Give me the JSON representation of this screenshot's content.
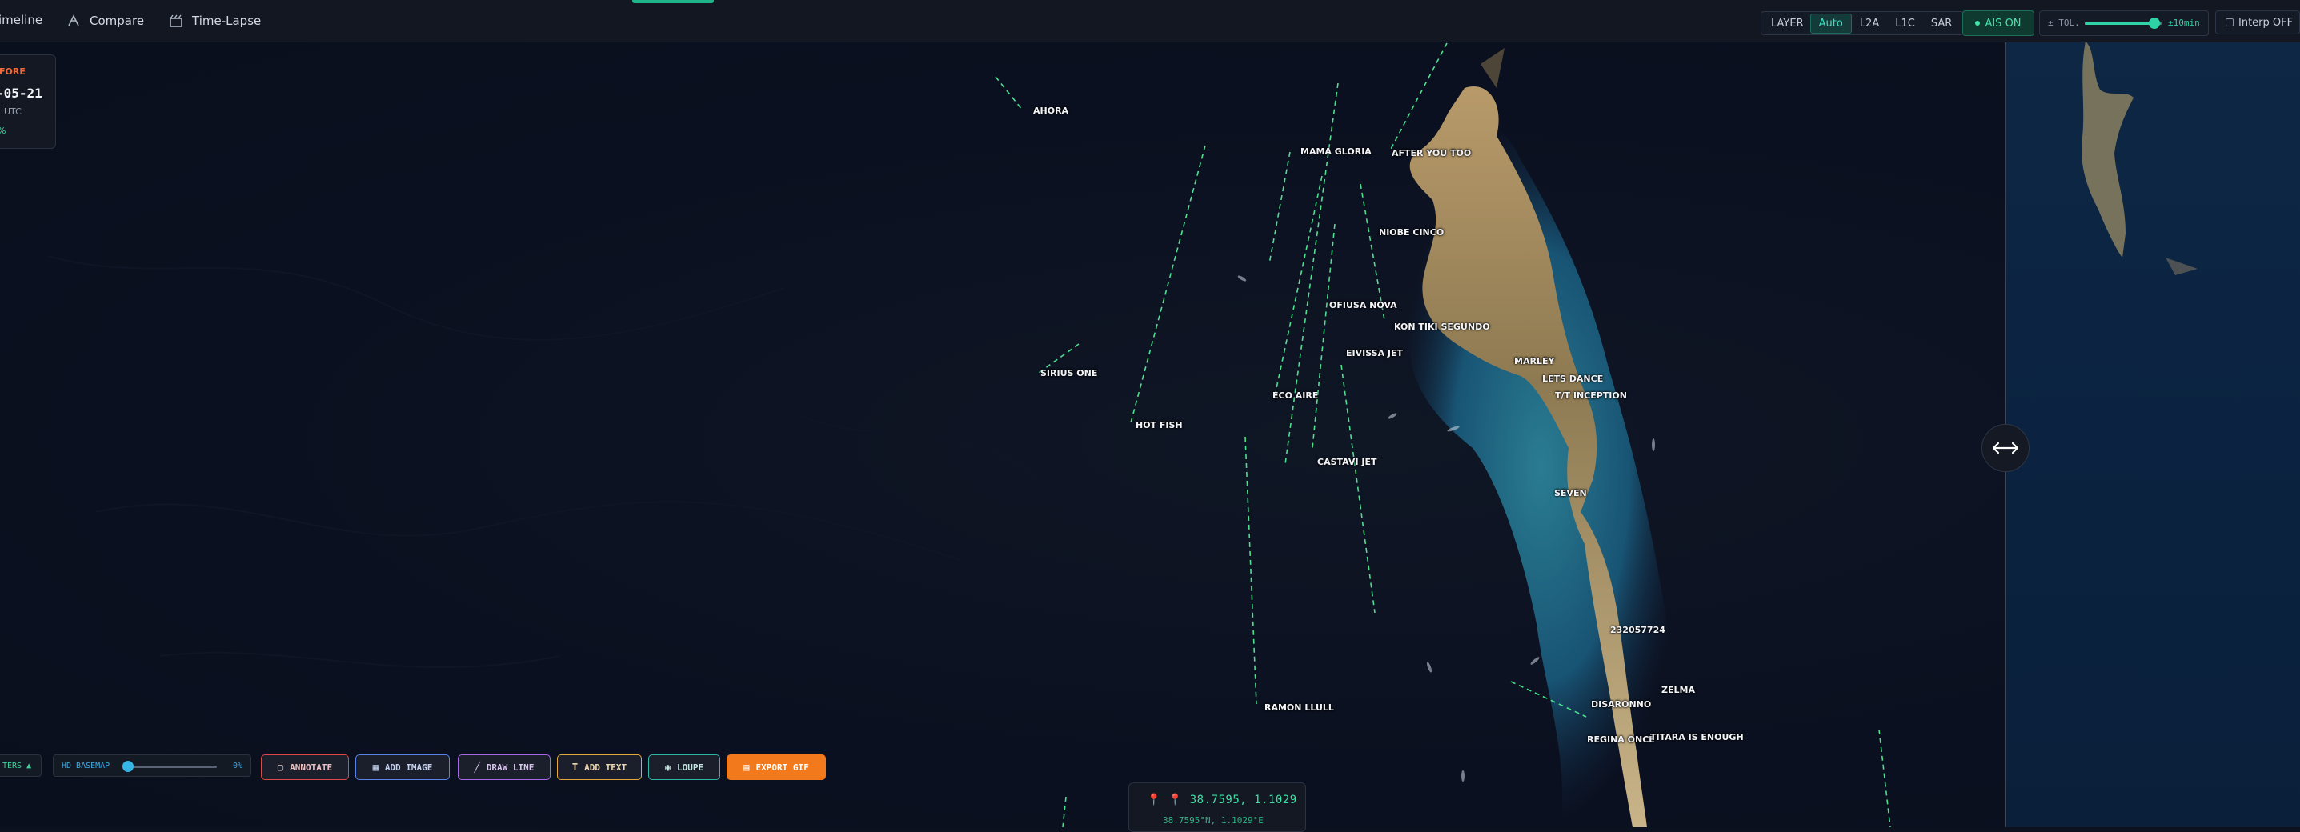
{
  "nav": {
    "tabs": [
      {
        "label": "imeline",
        "icon": "timeline-icon"
      },
      {
        "label": "Compare",
        "icon": "compare-icon"
      },
      {
        "label": "Time-Lapse",
        "icon": "time-lapse-icon"
      }
    ]
  },
  "layer": {
    "label": "LAYER",
    "options": [
      "Auto",
      "L2A",
      "L1C",
      "SAR"
    ],
    "selected": "Auto"
  },
  "ais": {
    "label": "AIS ON"
  },
  "tolerance": {
    "label": "± TOL.",
    "value": "±10min",
    "slider_fraction": 0.88
  },
  "interp": {
    "label": "Interp OFF"
  },
  "info_card": {
    "label": "FORE",
    "date": "-05-21",
    "tz": "UTC",
    "pct": "%"
  },
  "vessels": [
    "AHORA",
    "MAMA GLORIA",
    "AFTER YOU TOO",
    "NIOBE CINCO",
    "OFIUSA NOVA",
    "KON TIKI SEGUNDO",
    "EIVISSA JET",
    "SIRIUS ONE",
    "ECO AIRE",
    "MARLEY",
    "LETS DANCE",
    "T/T INCEPTION",
    "HOT FISH",
    "CASTAVI JET",
    "SEVEN",
    "232057724",
    "ZELMA",
    "DISARONNO",
    "REGINA ONCE",
    "TITARA IS ENOUGH",
    "RAMON LLULL"
  ],
  "bottom": {
    "filters": "TERS ▲",
    "hd_basemap": {
      "label": "HD BASEMAP",
      "value": "0%",
      "fraction": 0
    },
    "buttons": [
      {
        "label": "ANNOTATE",
        "icon": "annotate-icon",
        "color": "#e04848"
      },
      {
        "label": "ADD IMAGE",
        "icon": "add-image-icon",
        "color": "#5b82e6"
      },
      {
        "label": "DRAW LINE",
        "icon": "draw-line-icon",
        "color": "#a866e8"
      },
      {
        "label": "ADD TEXT",
        "icon": "add-text-icon",
        "color": "#e6a83a"
      },
      {
        "label": "LOUPE",
        "icon": "loupe-icon",
        "color": "#2fb5a6"
      },
      {
        "label": "EXPORT GIF",
        "icon": "export-gif-icon",
        "color": "#f27a1c"
      }
    ]
  },
  "coords": {
    "main": "38.7595, 1.1029",
    "sub": "38.7595°N, 1.1029°E"
  },
  "colors": {
    "accent": "#1fb48a",
    "track": "#4ee08f",
    "export": "#f27a1c"
  }
}
